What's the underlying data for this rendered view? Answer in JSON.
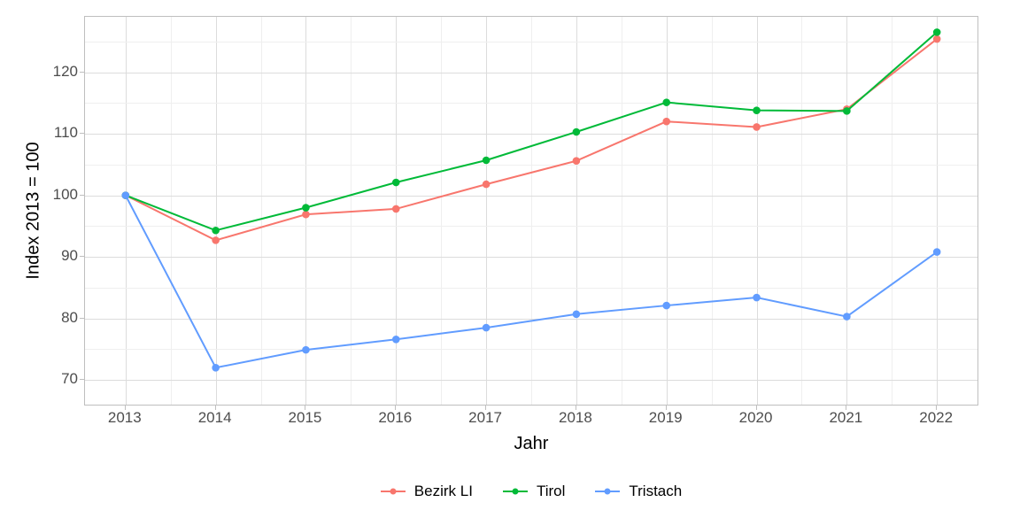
{
  "chart_data": {
    "type": "line",
    "xlabel": "Jahr",
    "ylabel": "Index  2013  =  100",
    "x_ticks": [
      2013,
      2014,
      2015,
      2016,
      2017,
      2018,
      2019,
      2020,
      2021,
      2022
    ],
    "y_ticks": [
      70,
      80,
      90,
      100,
      110,
      120
    ],
    "ylim": [
      66,
      129
    ],
    "xlim": [
      2012.55,
      2022.45
    ],
    "categories": [
      2013,
      2014,
      2015,
      2016,
      2017,
      2018,
      2019,
      2020,
      2021,
      2022
    ],
    "series": [
      {
        "name": "Bezirk LI",
        "color": "#F8766D",
        "values": [
          100.0,
          92.7,
          96.9,
          97.8,
          101.8,
          105.6,
          112.0,
          111.1,
          114.0,
          125.4
        ]
      },
      {
        "name": "Tirol",
        "color": "#00BA38",
        "values": [
          100.0,
          94.3,
          98.0,
          102.1,
          105.7,
          110.3,
          115.1,
          113.8,
          113.7,
          126.5
        ]
      },
      {
        "name": "Tristach",
        "color": "#619CFF",
        "values": [
          100.0,
          72.0,
          74.9,
          76.6,
          78.5,
          80.7,
          82.1,
          83.4,
          80.3,
          90.8
        ]
      }
    ],
    "legend_position": "bottom",
    "grid": true
  }
}
